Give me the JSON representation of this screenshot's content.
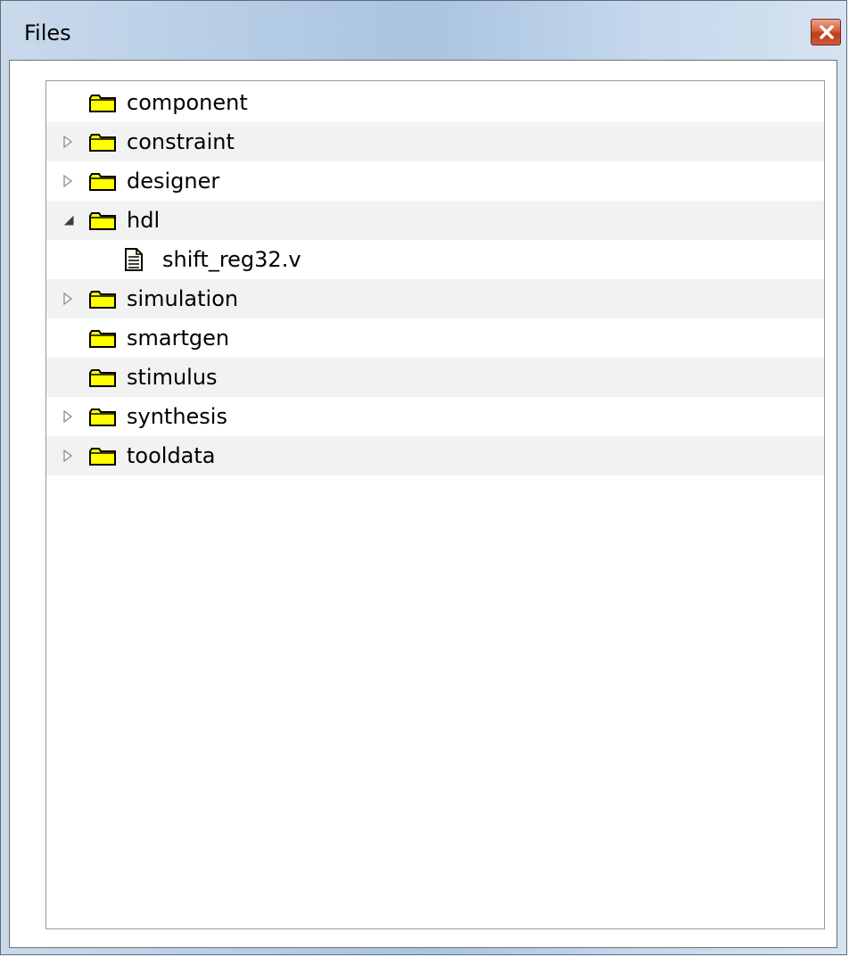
{
  "window": {
    "title": "Files"
  },
  "tree": {
    "items": [
      {
        "label": "component",
        "type": "folder",
        "expander": "none",
        "level": 0
      },
      {
        "label": "constraint",
        "type": "folder",
        "expander": "collapsed",
        "level": 0
      },
      {
        "label": "designer",
        "type": "folder",
        "expander": "collapsed",
        "level": 0
      },
      {
        "label": "hdl",
        "type": "folder",
        "expander": "expanded",
        "level": 0
      },
      {
        "label": "shift_reg32.v",
        "type": "file",
        "expander": "none",
        "level": 1
      },
      {
        "label": "simulation",
        "type": "folder",
        "expander": "collapsed",
        "level": 0
      },
      {
        "label": "smartgen",
        "type": "folder",
        "expander": "none",
        "level": 0
      },
      {
        "label": "stimulus",
        "type": "folder",
        "expander": "none",
        "level": 0
      },
      {
        "label": "synthesis",
        "type": "folder",
        "expander": "collapsed",
        "level": 0
      },
      {
        "label": "tooldata",
        "type": "folder",
        "expander": "collapsed",
        "level": 0
      }
    ]
  },
  "icons": {
    "close": "close-icon",
    "folder": "folder-icon",
    "file": "document-icon",
    "collapsed": "triangle-right-icon",
    "expanded": "triangle-down-icon"
  },
  "colors": {
    "folder_fill": "#ffff00",
    "folder_stroke": "#000000",
    "alt_row": "#f2f2f2",
    "close_button": "#c13c17"
  }
}
